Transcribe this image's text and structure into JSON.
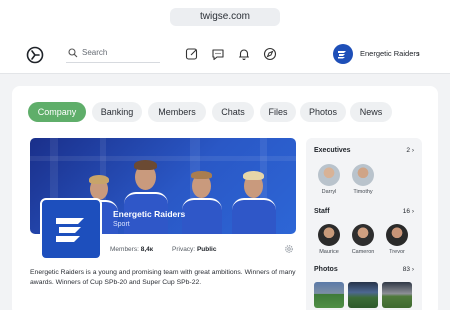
{
  "browser": {
    "url": "twigse.com"
  },
  "nav": {
    "search_placeholder": "Search",
    "icons": [
      "edit-icon",
      "chat-icon",
      "bell-icon",
      "compass-icon"
    ],
    "team_name": "Energetic Raiders",
    "team_chevron": "›"
  },
  "tabs": [
    {
      "label": "Company",
      "active": true
    },
    {
      "label": "Banking",
      "active": false
    },
    {
      "label": "Members",
      "active": false
    },
    {
      "label": "Chats",
      "active": false
    },
    {
      "label": "Files",
      "active": false
    },
    {
      "label": "Photos",
      "active": false
    },
    {
      "label": "News",
      "active": false
    }
  ],
  "profile": {
    "name": "Energetic Raiders",
    "category": "Sport",
    "members_label": "Members:",
    "members_value": "8,4к",
    "privacy_label": "Privacy:",
    "privacy_value": "Public",
    "description": "Energetic Raiders is a young and promising team with great ambitions. Winners of many awards. Winners of Cup SPb-20 and Super Cup SPb-22."
  },
  "sidebar": {
    "executives": {
      "title": "Executives",
      "count": "2",
      "people": [
        "Darryl",
        "Timothy"
      ]
    },
    "staff": {
      "title": "Staff",
      "count": "16",
      "people": [
        "Maurice",
        "Cameron",
        "Trevor"
      ]
    },
    "photos": {
      "title": "Photos",
      "count": "83"
    },
    "chevron": "›"
  },
  "colors": {
    "accent_green": "#5fae6a",
    "brand_blue": "#1d4fbd"
  }
}
